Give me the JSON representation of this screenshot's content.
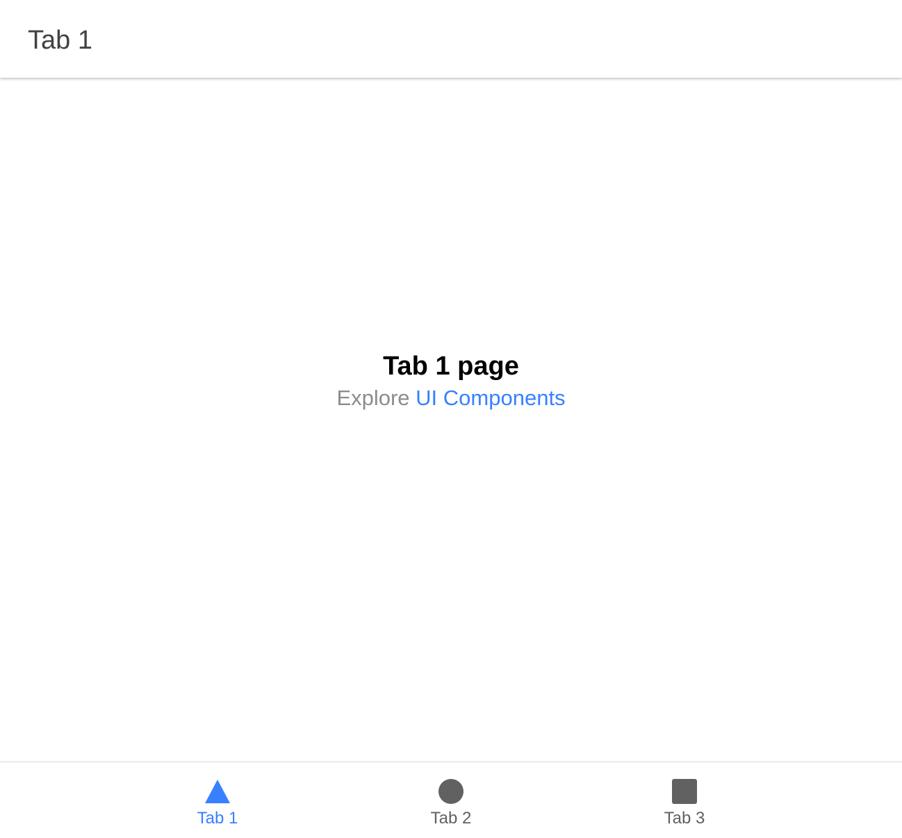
{
  "header": {
    "title": "Tab 1"
  },
  "main": {
    "heading": "Tab 1 page",
    "subtext_prefix": "Explore",
    "link_label": "UI Components"
  },
  "tabbar": {
    "tabs": [
      {
        "label": "Tab 1",
        "icon": "triangle-icon",
        "selected": true
      },
      {
        "label": "Tab 2",
        "icon": "ellipse-icon",
        "selected": false
      },
      {
        "label": "Tab 3",
        "icon": "square-icon",
        "selected": false
      }
    ]
  },
  "colors": {
    "accent": "#3880ff",
    "icon_inactive": "#616161",
    "title_text": "#424242",
    "muted_text": "#8c8c8c"
  }
}
